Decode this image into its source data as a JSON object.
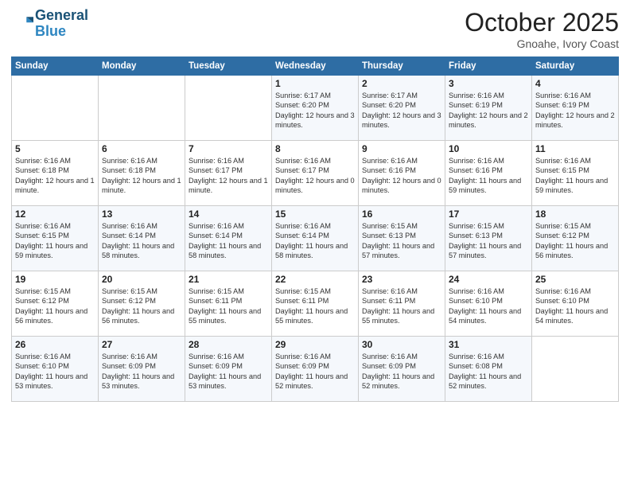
{
  "header": {
    "logo_line1": "General",
    "logo_line2": "Blue",
    "month": "October 2025",
    "location": "Gnoahe, Ivory Coast"
  },
  "weekdays": [
    "Sunday",
    "Monday",
    "Tuesday",
    "Wednesday",
    "Thursday",
    "Friday",
    "Saturday"
  ],
  "weeks": [
    [
      {
        "num": "",
        "info": ""
      },
      {
        "num": "",
        "info": ""
      },
      {
        "num": "",
        "info": ""
      },
      {
        "num": "1",
        "info": "Sunrise: 6:17 AM\nSunset: 6:20 PM\nDaylight: 12 hours and 3 minutes."
      },
      {
        "num": "2",
        "info": "Sunrise: 6:17 AM\nSunset: 6:20 PM\nDaylight: 12 hours and 3 minutes."
      },
      {
        "num": "3",
        "info": "Sunrise: 6:16 AM\nSunset: 6:19 PM\nDaylight: 12 hours and 2 minutes."
      },
      {
        "num": "4",
        "info": "Sunrise: 6:16 AM\nSunset: 6:19 PM\nDaylight: 12 hours and 2 minutes."
      }
    ],
    [
      {
        "num": "5",
        "info": "Sunrise: 6:16 AM\nSunset: 6:18 PM\nDaylight: 12 hours and 1 minute."
      },
      {
        "num": "6",
        "info": "Sunrise: 6:16 AM\nSunset: 6:18 PM\nDaylight: 12 hours and 1 minute."
      },
      {
        "num": "7",
        "info": "Sunrise: 6:16 AM\nSunset: 6:17 PM\nDaylight: 12 hours and 1 minute."
      },
      {
        "num": "8",
        "info": "Sunrise: 6:16 AM\nSunset: 6:17 PM\nDaylight: 12 hours and 0 minutes."
      },
      {
        "num": "9",
        "info": "Sunrise: 6:16 AM\nSunset: 6:16 PM\nDaylight: 12 hours and 0 minutes."
      },
      {
        "num": "10",
        "info": "Sunrise: 6:16 AM\nSunset: 6:16 PM\nDaylight: 11 hours and 59 minutes."
      },
      {
        "num": "11",
        "info": "Sunrise: 6:16 AM\nSunset: 6:15 PM\nDaylight: 11 hours and 59 minutes."
      }
    ],
    [
      {
        "num": "12",
        "info": "Sunrise: 6:16 AM\nSunset: 6:15 PM\nDaylight: 11 hours and 59 minutes."
      },
      {
        "num": "13",
        "info": "Sunrise: 6:16 AM\nSunset: 6:14 PM\nDaylight: 11 hours and 58 minutes."
      },
      {
        "num": "14",
        "info": "Sunrise: 6:16 AM\nSunset: 6:14 PM\nDaylight: 11 hours and 58 minutes."
      },
      {
        "num": "15",
        "info": "Sunrise: 6:16 AM\nSunset: 6:14 PM\nDaylight: 11 hours and 58 minutes."
      },
      {
        "num": "16",
        "info": "Sunrise: 6:15 AM\nSunset: 6:13 PM\nDaylight: 11 hours and 57 minutes."
      },
      {
        "num": "17",
        "info": "Sunrise: 6:15 AM\nSunset: 6:13 PM\nDaylight: 11 hours and 57 minutes."
      },
      {
        "num": "18",
        "info": "Sunrise: 6:15 AM\nSunset: 6:12 PM\nDaylight: 11 hours and 56 minutes."
      }
    ],
    [
      {
        "num": "19",
        "info": "Sunrise: 6:15 AM\nSunset: 6:12 PM\nDaylight: 11 hours and 56 minutes."
      },
      {
        "num": "20",
        "info": "Sunrise: 6:15 AM\nSunset: 6:12 PM\nDaylight: 11 hours and 56 minutes."
      },
      {
        "num": "21",
        "info": "Sunrise: 6:15 AM\nSunset: 6:11 PM\nDaylight: 11 hours and 55 minutes."
      },
      {
        "num": "22",
        "info": "Sunrise: 6:15 AM\nSunset: 6:11 PM\nDaylight: 11 hours and 55 minutes."
      },
      {
        "num": "23",
        "info": "Sunrise: 6:16 AM\nSunset: 6:11 PM\nDaylight: 11 hours and 55 minutes."
      },
      {
        "num": "24",
        "info": "Sunrise: 6:16 AM\nSunset: 6:10 PM\nDaylight: 11 hours and 54 minutes."
      },
      {
        "num": "25",
        "info": "Sunrise: 6:16 AM\nSunset: 6:10 PM\nDaylight: 11 hours and 54 minutes."
      }
    ],
    [
      {
        "num": "26",
        "info": "Sunrise: 6:16 AM\nSunset: 6:10 PM\nDaylight: 11 hours and 53 minutes."
      },
      {
        "num": "27",
        "info": "Sunrise: 6:16 AM\nSunset: 6:09 PM\nDaylight: 11 hours and 53 minutes."
      },
      {
        "num": "28",
        "info": "Sunrise: 6:16 AM\nSunset: 6:09 PM\nDaylight: 11 hours and 53 minutes."
      },
      {
        "num": "29",
        "info": "Sunrise: 6:16 AM\nSunset: 6:09 PM\nDaylight: 11 hours and 52 minutes."
      },
      {
        "num": "30",
        "info": "Sunrise: 6:16 AM\nSunset: 6:09 PM\nDaylight: 11 hours and 52 minutes."
      },
      {
        "num": "31",
        "info": "Sunrise: 6:16 AM\nSunset: 6:08 PM\nDaylight: 11 hours and 52 minutes."
      },
      {
        "num": "",
        "info": ""
      }
    ]
  ]
}
